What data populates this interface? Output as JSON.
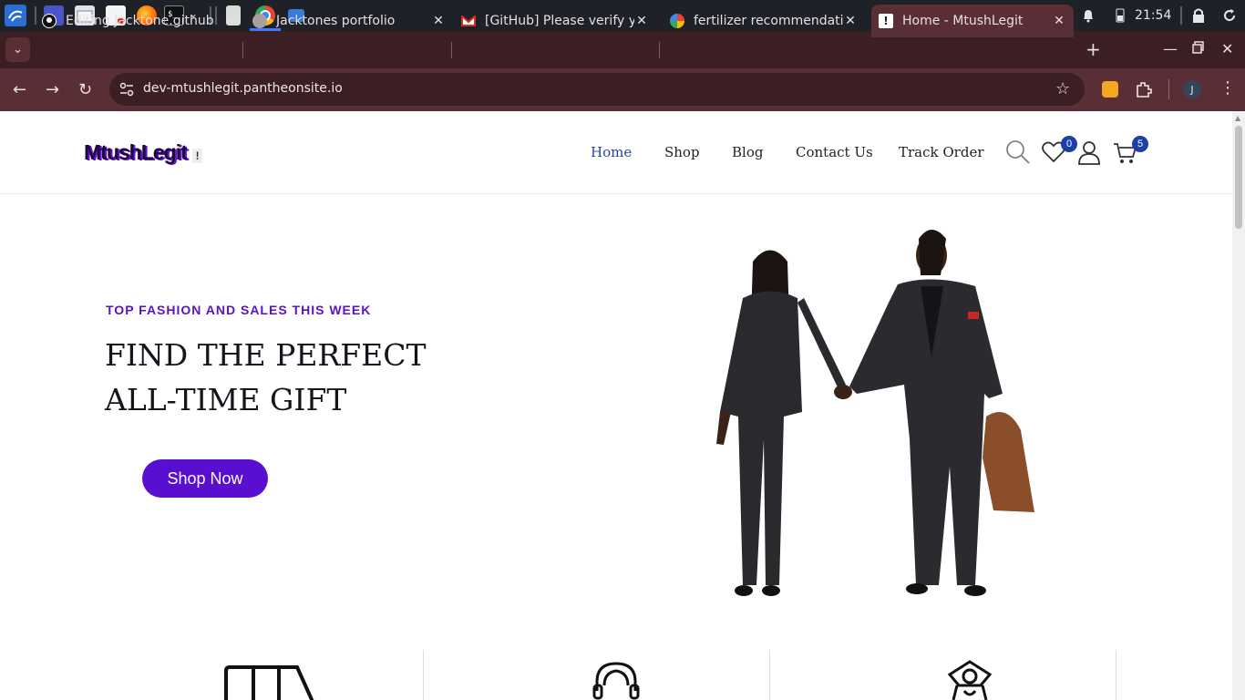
{
  "taskbar": {
    "clock": "21:54",
    "icons": [
      "kali-menu-icon",
      "workspace-icon",
      "file-manager-icon",
      "text-editor-icon",
      "firefox-icon",
      "terminal-icon",
      "chrome-icon",
      "folder-icon"
    ]
  },
  "tabs": [
    {
      "title": "Editing Jacktone.github",
      "icon": "github-icon",
      "active": false
    },
    {
      "title": "Jacktones portfolio",
      "icon": "globe-icon",
      "active": false
    },
    {
      "title": "[GitHub] Please verify y",
      "icon": "gmail-icon",
      "active": false
    },
    {
      "title": "fertilizer recommendati",
      "icon": "google-icon",
      "active": false
    },
    {
      "title": "Home - MtushLegit",
      "icon": "alert-icon",
      "active": true
    }
  ],
  "omnibox": {
    "url": "dev-mtushlegit.pantheonsite.io"
  },
  "profile_initial": "J",
  "site": {
    "logo": "MtushLegit",
    "nav": [
      "Home",
      "Shop",
      "Blog",
      "Contact Us",
      "Track Order"
    ],
    "wishlist_count": "0",
    "cart_count": "5",
    "colors": {
      "accent": "#5a0fd0",
      "nav_active": "#2845a0",
      "badge": "#1c3fa8"
    }
  },
  "hero": {
    "eyebrow": "TOP FASHION AND SALES THIS WEEK",
    "title_line1": "FIND THE PERFECT",
    "title_line2": "ALL-TIME GIFT",
    "cta": "Shop Now"
  },
  "features": {
    "icons": [
      "delivery-truck-icon",
      "support-headset-icon",
      "money-icon"
    ]
  }
}
